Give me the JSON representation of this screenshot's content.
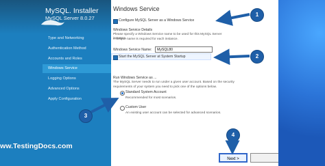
{
  "sidebar": {
    "title": "MySQL. Installer",
    "subtitle": "MySQL Server 8.0.27",
    "items": [
      "Type and Networking",
      "Authentication Method",
      "Accounts and Roles",
      "Windows Service",
      "Logging Options",
      "Advanced Options",
      "Apply Configuration"
    ],
    "active_index": 3
  },
  "page": {
    "title": "Windows Service",
    "configure_as_service_label": "Configure MySQL Server as a Windows Service",
    "details_header": "Windows Service Details",
    "details_desc_1": "Please specify a Windows Service name to be used for this MySQL Server instance.",
    "details_desc_2": "A unique name is required for each instance.",
    "service_name_label": "Windows Service Name:",
    "service_name_value": "MySQL80",
    "start_at_startup_label": "Start the MySQL Server at System Startup",
    "run_as_header": "Run Windows Service as ...",
    "run_as_desc_1": "The MySQL Server needs to run under a given user account. Based on the security",
    "run_as_desc_2": "requirements of your system you need to pick one of the options below.",
    "standard_account_label": "Standard System Account",
    "standard_account_desc": "Recommended for most scenarios.",
    "custom_user_label": "Custom User",
    "custom_user_desc": "An existing user account can be selected for advanced scenarios."
  },
  "footer": {
    "watermark": "www.TestingDocs.com",
    "next_button": "Next >",
    "secondary_button": ""
  },
  "callouts": [
    "1",
    "2",
    "3",
    "4"
  ],
  "colors": {
    "sidebar_bg": "#1c7fbf",
    "active_item": "#2e9ad6",
    "accent": "#1f5fa8"
  }
}
